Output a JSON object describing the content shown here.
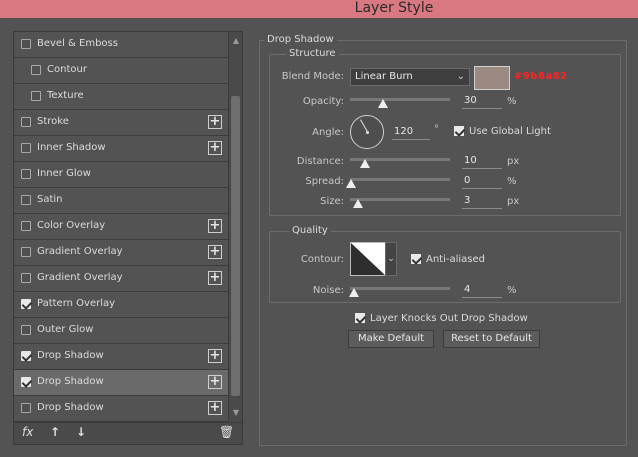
{
  "window": {
    "title": "Layer Style"
  },
  "styles_list": {
    "items": [
      {
        "label": "Bevel & Emboss",
        "checked": false,
        "indent": false,
        "has_plus": false,
        "selected": false
      },
      {
        "label": "Contour",
        "checked": false,
        "indent": true,
        "has_plus": false,
        "selected": false
      },
      {
        "label": "Texture",
        "checked": false,
        "indent": true,
        "has_plus": false,
        "selected": false
      },
      {
        "label": "Stroke",
        "checked": false,
        "indent": false,
        "has_plus": true,
        "selected": false
      },
      {
        "label": "Inner Shadow",
        "checked": false,
        "indent": false,
        "has_plus": true,
        "selected": false
      },
      {
        "label": "Inner Glow",
        "checked": false,
        "indent": false,
        "has_plus": false,
        "selected": false
      },
      {
        "label": "Satin",
        "checked": false,
        "indent": false,
        "has_plus": false,
        "selected": false
      },
      {
        "label": "Color Overlay",
        "checked": false,
        "indent": false,
        "has_plus": true,
        "selected": false
      },
      {
        "label": "Gradient Overlay",
        "checked": false,
        "indent": false,
        "has_plus": true,
        "selected": false
      },
      {
        "label": "Gradient Overlay",
        "checked": false,
        "indent": false,
        "has_plus": true,
        "selected": false
      },
      {
        "label": "Pattern Overlay",
        "checked": true,
        "indent": false,
        "has_plus": false,
        "selected": false
      },
      {
        "label": "Outer Glow",
        "checked": false,
        "indent": false,
        "has_plus": false,
        "selected": false
      },
      {
        "label": "Drop Shadow",
        "checked": true,
        "indent": false,
        "has_plus": true,
        "selected": false
      },
      {
        "label": "Drop Shadow",
        "checked": true,
        "indent": false,
        "has_plus": true,
        "selected": true
      },
      {
        "label": "Drop Shadow",
        "checked": false,
        "indent": false,
        "has_plus": true,
        "selected": false
      }
    ],
    "bottom_icons": {
      "fx": "fx",
      "up": "↑",
      "down": "↓",
      "trash": "🗑"
    }
  },
  "drop_shadow": {
    "section_title": "Drop Shadow",
    "structure_title": "Structure",
    "blend_mode_label": "Blend Mode:",
    "blend_mode_value": "Linear Burn",
    "color_hex": "#9b8a82",
    "color_hex_label": "#9b8a82",
    "opacity_label": "Opacity:",
    "opacity_value": "30",
    "opacity_unit": "%",
    "angle_label": "Angle:",
    "angle_value": "120",
    "angle_unit": "°",
    "use_global_light_label": "Use Global Light",
    "use_global_light_checked": true,
    "distance_label": "Distance:",
    "distance_value": "10",
    "distance_unit": "px",
    "spread_label": "Spread:",
    "spread_value": "0",
    "spread_unit": "%",
    "size_label": "Size:",
    "size_value": "3",
    "size_unit": "px",
    "quality_title": "Quality",
    "contour_label": "Contour:",
    "anti_aliased_label": "Anti-aliased",
    "anti_aliased_checked": true,
    "noise_label": "Noise:",
    "noise_value": "4",
    "noise_unit": "%",
    "knockout_label": "Layer Knocks Out Drop Shadow",
    "knockout_checked": true,
    "make_default_label": "Make Default",
    "reset_default_label": "Reset to Default"
  }
}
